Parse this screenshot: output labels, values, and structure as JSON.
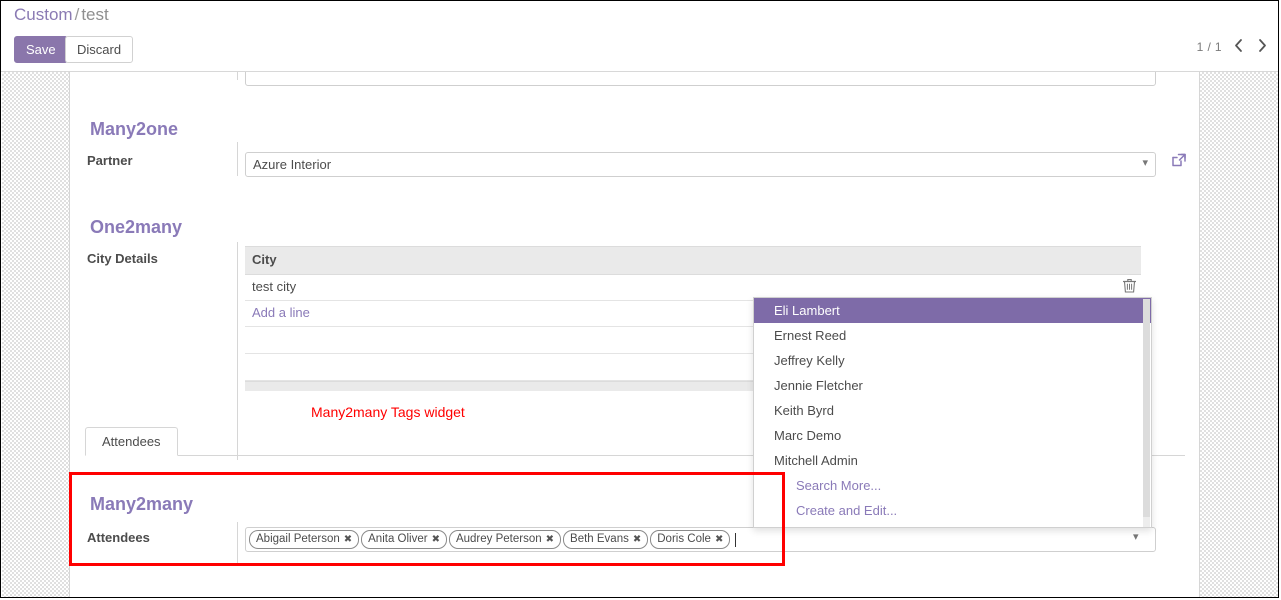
{
  "breadcrumb": {
    "root": "Custom",
    "separator": "/",
    "current": "test"
  },
  "toolbar": {
    "save_label": "Save",
    "discard_label": "Discard"
  },
  "pager": {
    "count": "1 / 1",
    "prev_icon": "chevron-left-icon",
    "next_icon": "chevron-right-icon"
  },
  "many2one": {
    "group_title": "Many2one",
    "field_label": "Partner",
    "field_value": "Azure Interior",
    "external_link_icon": "external-link-icon"
  },
  "one2many": {
    "group_title": "One2many",
    "field_label": "City Details",
    "column_header": "City",
    "rows": [
      {
        "city": "test city",
        "delete_icon": "trash-icon"
      }
    ],
    "add_line_label": "Add a line"
  },
  "annotations": {
    "tags_widget": "Many2many Tags widget"
  },
  "notebook": {
    "tabs": [
      {
        "label": "Attendees",
        "active": true
      }
    ]
  },
  "many2many": {
    "group_title": "Many2many",
    "field_label": "Attendees",
    "tags": [
      {
        "label": "Abigail Peterson",
        "remove_icon": "close-icon"
      },
      {
        "label": "Anita Oliver",
        "remove_icon": "close-icon"
      },
      {
        "label": "Audrey Peterson",
        "remove_icon": "close-icon"
      },
      {
        "label": "Beth Evans",
        "remove_icon": "close-icon"
      },
      {
        "label": "Doris Cole",
        "remove_icon": "close-icon"
      }
    ],
    "dropdown_caret_icon": "chevron-down-icon"
  },
  "autocomplete": {
    "items": [
      {
        "label": "Eli Lambert",
        "active": true,
        "kind": "record"
      },
      {
        "label": "Ernest Reed",
        "active": false,
        "kind": "record"
      },
      {
        "label": "Jeffrey Kelly",
        "active": false,
        "kind": "record"
      },
      {
        "label": "Jennie Fletcher",
        "active": false,
        "kind": "record"
      },
      {
        "label": "Keith Byrd",
        "active": false,
        "kind": "record"
      },
      {
        "label": "Marc Demo",
        "active": false,
        "kind": "record"
      },
      {
        "label": "Mitchell Admin",
        "active": false,
        "kind": "record"
      },
      {
        "label": "Search More...",
        "active": false,
        "kind": "action"
      },
      {
        "label": "Create and Edit...",
        "active": false,
        "kind": "action"
      }
    ]
  },
  "colors": {
    "brand_purple": "#8a7ab8",
    "save_button": "#8a76ab",
    "highlight_row": "#7e6ba8",
    "annotation_red": "#ff0000",
    "text": "#4c4c4c"
  }
}
